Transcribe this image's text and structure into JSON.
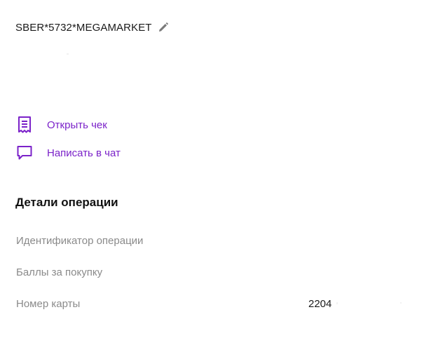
{
  "header": {
    "title": "SBER*5732*MEGAMARKET"
  },
  "actions": [
    {
      "label": "Открыть чек",
      "icon": "receipt-icon"
    },
    {
      "label": "Написать в чат",
      "icon": "chat-icon"
    }
  ],
  "details": {
    "section_title": "Детали операции",
    "rows": [
      {
        "label": "Идентификатор операции",
        "value": ""
      },
      {
        "label": "Баллы за покупку",
        "value": ""
      },
      {
        "label": "Номер карты",
        "value": "2204"
      }
    ]
  },
  "colors": {
    "accent": "#7b22c9",
    "muted_text": "#8a8a8a",
    "text": "#1a1a1a"
  }
}
